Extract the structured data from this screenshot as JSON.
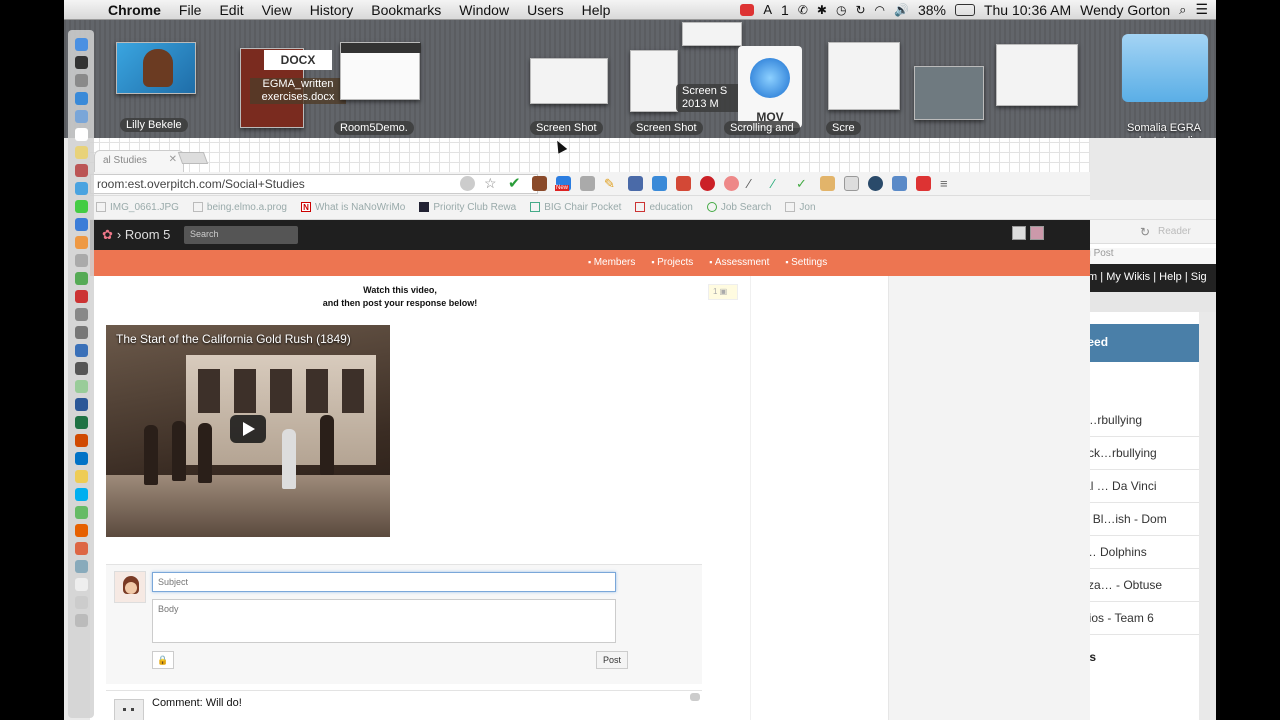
{
  "menubar": {
    "app_name": "Chrome",
    "menus": [
      "File",
      "Edit",
      "View",
      "History",
      "Bookmarks",
      "Window",
      "Users",
      "Help"
    ],
    "battery": "38%",
    "clock": "Thu 10:36 AM",
    "user": "Wendy Gorton",
    "tray_counter": "1"
  },
  "desktop": {
    "docx_badge": "DOCX",
    "egma_label": "EGMA_written exercises.docx",
    "photo_label": "Lilly Bekele",
    "room5_label": "Room5Demo.",
    "screenshot_label_1": "Screen Shot",
    "screenshot_label_2": "Screen Shot",
    "scrolling_label": "Scrolling and",
    "screen_label_partial": "Scre",
    "mov_label": "MOV",
    "screen_shot_2013": "Screen S 2013 M",
    "folder_label": "Somalia EGRA adaptat media"
  },
  "browser": {
    "tab_title": "al Studies",
    "url": "room:est.overpitch.com/Social+Studies",
    "bookmarks": [
      {
        "label": "IMG_0661.JPG"
      },
      {
        "label": "being.elmo.a.prog"
      },
      {
        "label": "What is NaNoWriMo"
      },
      {
        "label": "Priority Club Rewa"
      },
      {
        "label": "BIG Chair Pocket"
      },
      {
        "label": "education"
      },
      {
        "label": "Job Search"
      },
      {
        "label": "Jon"
      }
    ],
    "extension_new_badge": "New"
  },
  "room": {
    "title": "Room 5",
    "search_placeholder": "Search",
    "nav": [
      "Members",
      "Projects",
      "Assessment",
      "Settings"
    ],
    "intro_line1": "Watch this video,",
    "intro_line2": "and then post your response below!",
    "intro_badge": "1",
    "video_title": "The Start of the California Gold Rush (1849)",
    "subject_placeholder": "Subject",
    "body_placeholder": "Body",
    "lock_icon_label": "🔒",
    "post_label": "Post",
    "comment_text": "Comment: Will do!"
  },
  "bg_window": {
    "reader_label": "Reader",
    "tab_label": "ity Blog Post",
    "user_links": "Dom | My Wikis | Help | Sig",
    "news_feed": "ews Feed",
    "pages_head": "ages",
    "items": [
      "igital I…rbullying",
      "oby Dick…rbullying",
      "ersonal … Da Vinci",
      "Veekly Bl…ish - Dom",
      "t Circl… Dolphins",
      "ath Wiza… - Obtuse",
      "Portfolios - Team 6"
    ],
    "all_pages_head": "l Pages",
    "home_item": "ome"
  }
}
